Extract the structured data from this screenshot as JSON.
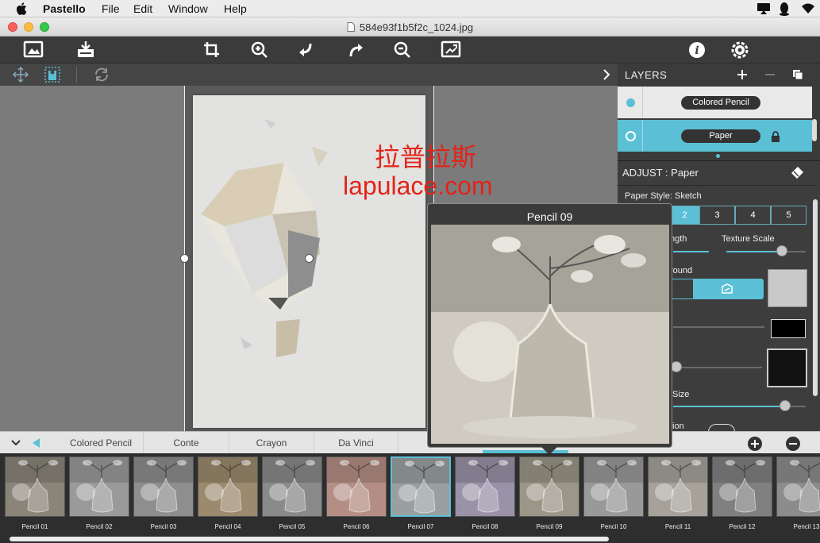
{
  "menubar": {
    "app_name": "Pastello",
    "items": [
      "File",
      "Edit",
      "Window",
      "Help"
    ]
  },
  "window": {
    "title": "584e93f1b5f2c_1024.jpg"
  },
  "watermark": {
    "line1": "拉普拉斯",
    "line2": "lapulace.com"
  },
  "layers": {
    "title": "LAYERS",
    "items": [
      {
        "name": "Colored Pencil"
      },
      {
        "name": "Paper"
      }
    ]
  },
  "adjust": {
    "title": "ADJUST : Paper",
    "paper_style_label": "Paper Style: Sketch",
    "styles": [
      "2",
      "3",
      "4",
      "5"
    ],
    "strength_label": "ngth",
    "texture_scale_label": "Texture Scale",
    "background_label": "round",
    "size_label": "Size",
    "bottom_label": "tion"
  },
  "popup": {
    "title": "Pencil 09"
  },
  "tabs": [
    "Colored Pencil",
    "Conte",
    "Crayon",
    "Da Vinci"
  ],
  "thumbnails": [
    {
      "label": "Pencil 01",
      "tint": "#8a8578"
    },
    {
      "label": "Pencil 02",
      "tint": "#9a9a9a"
    },
    {
      "label": "Pencil 03",
      "tint": "#8e8e8e"
    },
    {
      "label": "Pencil 04",
      "tint": "#9c8a6e"
    },
    {
      "label": "Pencil 05",
      "tint": "#8a8a8a"
    },
    {
      "label": "Pencil 06",
      "tint": "#b48e84"
    },
    {
      "label": "Pencil 07",
      "tint": "#9aa0a0"
    },
    {
      "label": "Pencil 08",
      "tint": "#9a92a8"
    },
    {
      "label": "Pencil 09",
      "tint": "#9c9688"
    },
    {
      "label": "Pencil 10",
      "tint": "#999999"
    },
    {
      "label": "Pencil 11",
      "tint": "#a6a29a"
    },
    {
      "label": "Pencil 12",
      "tint": "#808080"
    },
    {
      "label": "Pencil 13",
      "tint": "#8c8c8c"
    }
  ],
  "colors": {
    "accent": "#5bc0d6",
    "toolbar": "#3b3b3b",
    "canvas": "#7b7b7b"
  }
}
